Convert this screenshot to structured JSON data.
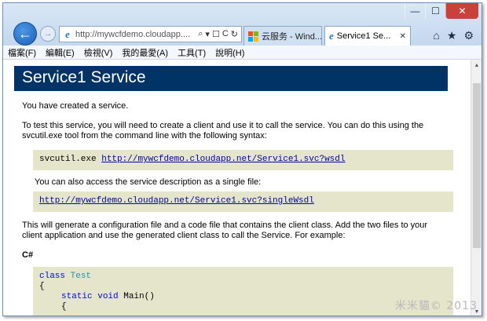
{
  "caption": {
    "minimize": "—",
    "maximize": "☐",
    "close": "✕"
  },
  "nav": {
    "back": "←",
    "forward": "→"
  },
  "address": {
    "url": "http://mywcfdemo.cloudapp....",
    "search": "⌕",
    "dropdown": "▾",
    "lock": "☐",
    "refresh": "C",
    "refresh_arrow": "↻"
  },
  "tabs": [
    {
      "label": "云服务 - Wind...",
      "close": ""
    },
    {
      "label": "Service1 Se...",
      "close": "✕"
    }
  ],
  "tools": {
    "home": "⌂",
    "favorites": "★",
    "settings": "⚙"
  },
  "menu": [
    "檔案(F)",
    "編輯(E)",
    "檢視(V)",
    "我的最愛(A)",
    "工具(T)",
    "說明(H)"
  ],
  "page": {
    "title": "Service1 Service",
    "p1": "You have created a service.",
    "p2": "To test this service, you will need to create a client and use it to call the service. You can do this using the svcutil.exe tool from the command line with the following syntax:",
    "cmd": "svcutil.exe",
    "wsdl_url": "http://mywcfdemo.cloudapp.net/Service1.svc?wsdl",
    "p3": "You can also access the service description as a single file:",
    "single_wsdl_url": "http://mywcfdemo.cloudapp.net/Service1.svc?singleWsdl",
    "p4": "This will generate a configuration file and a code file that contains the client class. Add the two files to your client application and use the generated client class to call the Service. For example:",
    "lang": "C#",
    "code": {
      "kw_class": "class",
      "cls_name": "Test",
      "brace_open": "{",
      "kw_static": "static",
      "kw_void": "void",
      "method": "Main()",
      "brace_inner": "{"
    }
  },
  "scroll": {
    "up": "▲",
    "down": "▼"
  },
  "watermark": "米米貓© 2013"
}
